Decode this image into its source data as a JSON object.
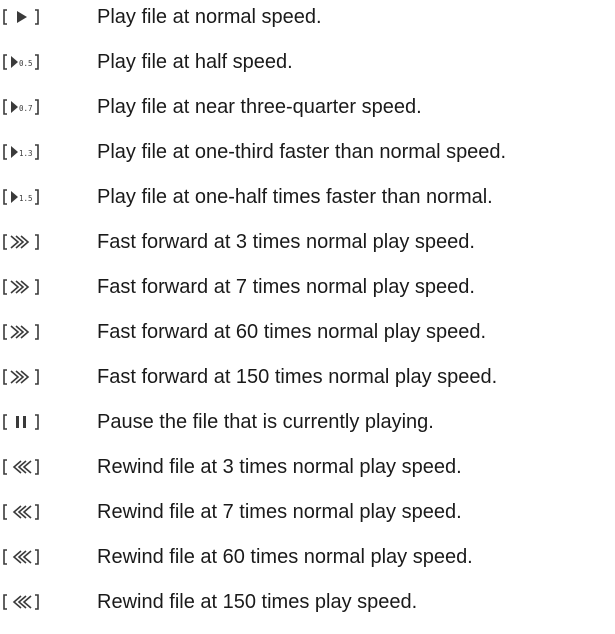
{
  "legend": {
    "items": [
      {
        "icon": "play-normal-icon",
        "text": "Play file at normal speed."
      },
      {
        "icon": "play-half-speed-icon",
        "badge": "0.5",
        "text": "Play file at half speed."
      },
      {
        "icon": "play-three-quarter-speed-icon",
        "badge": "0.7",
        "text": "Play file at near three-quarter speed."
      },
      {
        "icon": "play-one-third-faster-icon",
        "badge": "1.3",
        "text": "Play file at one-third faster than normal speed."
      },
      {
        "icon": "play-one-half-faster-icon",
        "badge": "1.5",
        "text": "Play file at one-half times faster than normal."
      },
      {
        "icon": "fast-forward-icon",
        "text": "Fast forward at 3 times normal play speed."
      },
      {
        "icon": "fast-forward-icon",
        "text": "Fast forward at 7 times normal play speed."
      },
      {
        "icon": "fast-forward-icon",
        "text": "Fast forward at 60 times normal play speed."
      },
      {
        "icon": "fast-forward-icon",
        "text": "Fast forward at 150 times normal play speed."
      },
      {
        "icon": "pause-icon",
        "text": "Pause the file that is currently playing."
      },
      {
        "icon": "rewind-icon",
        "text": "Rewind file at 3 times normal play speed."
      },
      {
        "icon": "rewind-icon",
        "text": "Rewind file at 7 times normal play speed."
      },
      {
        "icon": "rewind-icon",
        "text": "Rewind file at 60 times normal play speed."
      },
      {
        "icon": "rewind-icon",
        "text": "Rewind file at 150 times play speed."
      }
    ]
  }
}
